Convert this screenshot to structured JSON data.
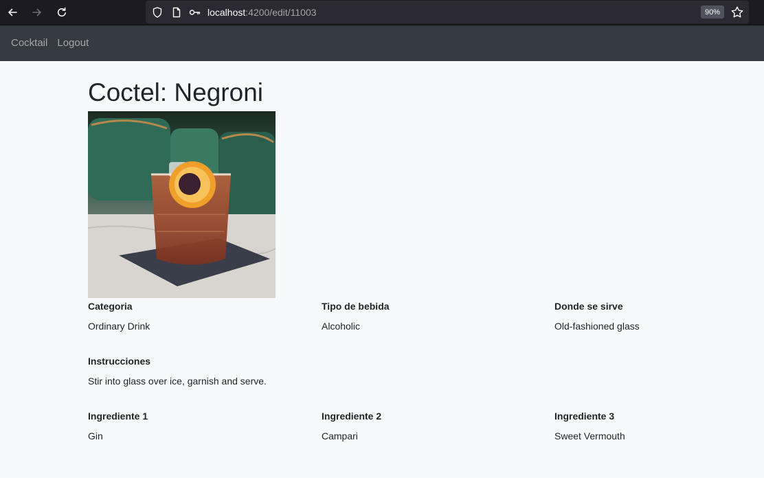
{
  "browser": {
    "url_host": "localhost",
    "url_path": ":4200/edit/11003",
    "zoom": "90%",
    "icons": [
      "back-arrow-icon",
      "forward-arrow-icon",
      "reload-icon",
      "shield-icon",
      "page-icon",
      "key-icon",
      "star-icon"
    ]
  },
  "navbar": {
    "items": [
      {
        "label": "Cocktail"
      },
      {
        "label": "Logout"
      }
    ]
  },
  "cocktail": {
    "title": "Coctel: Negroni",
    "details": {
      "category": {
        "label": "Categoria",
        "value": "Ordinary Drink"
      },
      "drink_type": {
        "label": "Tipo de bebida",
        "value": "Alcoholic"
      },
      "glass": {
        "label": "Donde se sirve",
        "value": "Old-fashioned glass"
      },
      "instructions": {
        "label": "Instrucciones",
        "value": "Stir into glass over ice, garnish and serve."
      }
    },
    "ingredients": [
      {
        "label": "Ingrediente 1",
        "value": "Gin"
      },
      {
        "label": "Ingrediente 2",
        "value": "Campari"
      },
      {
        "label": "Ingrediente 3",
        "value": "Sweet Vermouth"
      }
    ]
  },
  "colors": {
    "browser_bg": "#1c1b22",
    "urlbar_bg": "#2b2a33",
    "navbar_bg": "#343a40",
    "page_bg": "#f8f9fa",
    "text": "#212529"
  }
}
